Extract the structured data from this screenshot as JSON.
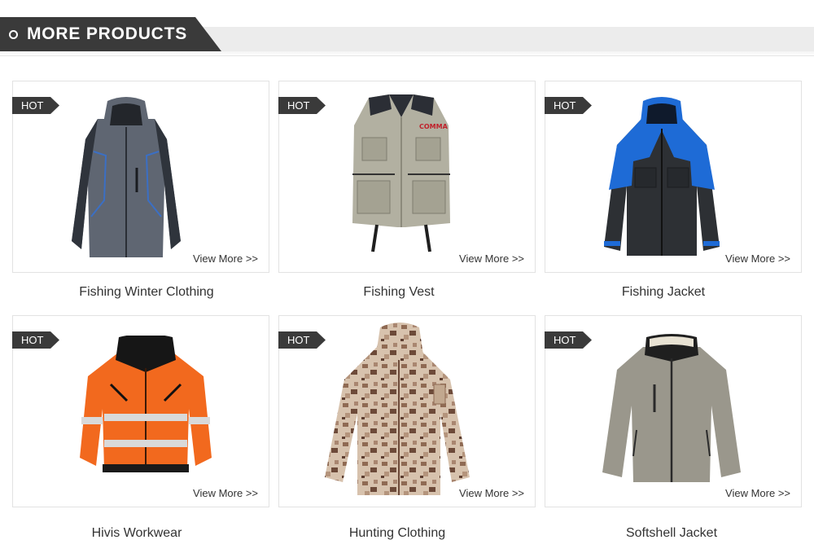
{
  "section": {
    "title": "MORE PRODUCTS"
  },
  "badge_label": "HOT",
  "view_more_label": "View More >>",
  "products": [
    {
      "name": "Fishing Winter Clothing"
    },
    {
      "name": "Fishing Vest"
    },
    {
      "name": "Fishing Jacket"
    },
    {
      "name": "Hivis Workwear"
    },
    {
      "name": "Hunting Clothing"
    },
    {
      "name": "Softshell Jacket"
    }
  ],
  "vest_logo_text": "COMMA",
  "colors": {
    "header_dark": "#3a3a3a",
    "header_band": "#ececec",
    "card_border": "#e2e2e2"
  }
}
